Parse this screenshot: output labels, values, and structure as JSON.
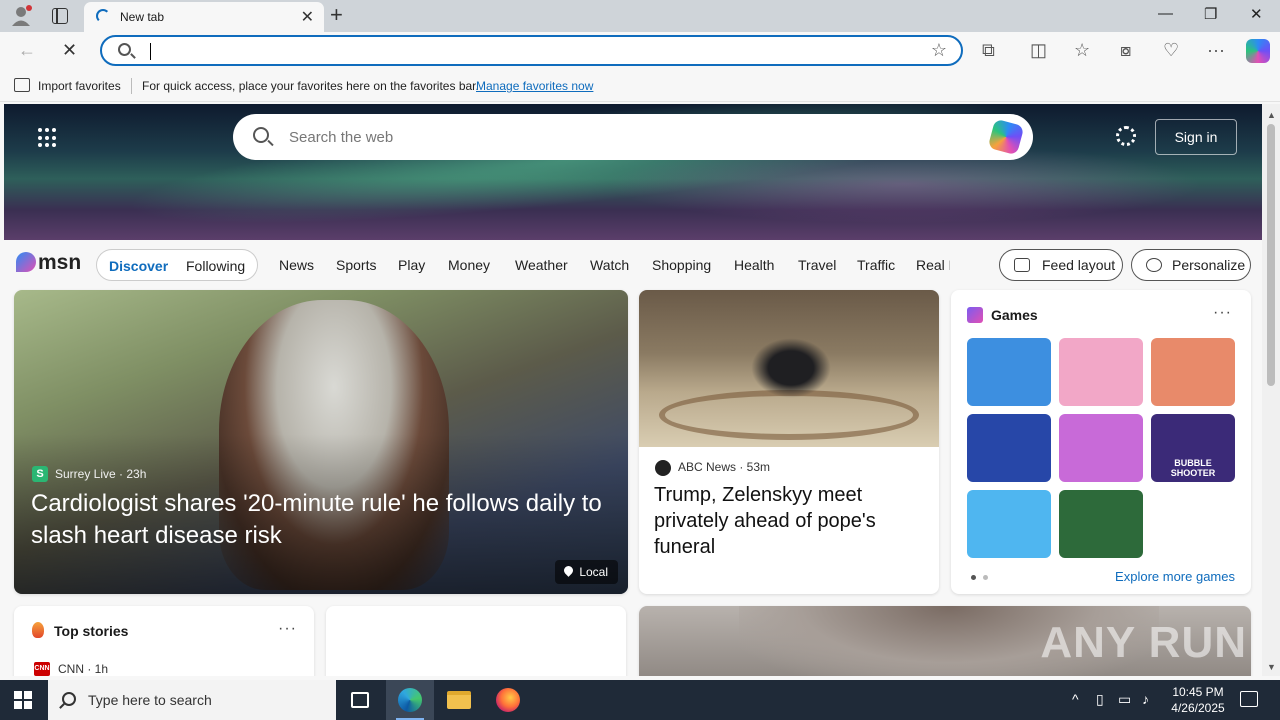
{
  "browser": {
    "tab_title": "New tab",
    "address_value": "",
    "favorites_bar": {
      "import_label": "Import favorites",
      "hint": "For quick access, place your favorites here on the favorites bar.",
      "manage_link": "Manage favorites now"
    }
  },
  "hero": {
    "search_placeholder": "Search the web",
    "signin_label": "Sign in"
  },
  "msn": {
    "logo": "msn",
    "segments": {
      "discover": "Discover",
      "following": "Following"
    },
    "nav": [
      "News",
      "Sports",
      "Play",
      "Money",
      "Weather",
      "Watch",
      "Shopping",
      "Health",
      "Travel",
      "Traffic",
      "Real E"
    ],
    "feed_layout": "Feed layout",
    "personalize": "Personalize"
  },
  "hero_story": {
    "source_initial": "S",
    "source": "Surrey Live · 23h",
    "headline": "Cardiologist shares '20-minute rule' he follows daily to slash heart disease risk",
    "badge": "Local"
  },
  "news_story": {
    "source": "ABC News · 53m",
    "headline": "Trump, Zelenskyy meet privately ahead of pope's funeral"
  },
  "games": {
    "title": "Games",
    "more_label": "···",
    "tiles": [
      {
        "name": "game-tile-1",
        "color": "#3d8fe0",
        "label": ""
      },
      {
        "name": "game-tile-2",
        "color": "#f2a7c7",
        "label": ""
      },
      {
        "name": "game-tile-3",
        "color": "#e88a6a",
        "label": ""
      },
      {
        "name": "game-tile-4",
        "color": "#2747a8",
        "label": ""
      },
      {
        "name": "game-tile-5",
        "color": "#c86ad8",
        "label": ""
      },
      {
        "name": "game-tile-6",
        "color": "#3b2a78",
        "label": "BUBBLE SHOOTER"
      },
      {
        "name": "game-tile-7",
        "color": "#4fb6f0",
        "label": ""
      },
      {
        "name": "game-tile-8",
        "color": "#2d6a3a",
        "label": ""
      }
    ],
    "explore": "Explore more games"
  },
  "top_stories": {
    "title": "Top stories",
    "more_label": "···",
    "cnn_logo": "CNN",
    "first_source": "CNN · 1h"
  },
  "watermark": "ANY RUN",
  "taskbar": {
    "search_placeholder": "Type here to search",
    "time": "10:45 PM",
    "date": "4/26/2025"
  },
  "colors": {
    "accent": "#0f6cbd",
    "taskbar": "#1f2a38"
  }
}
